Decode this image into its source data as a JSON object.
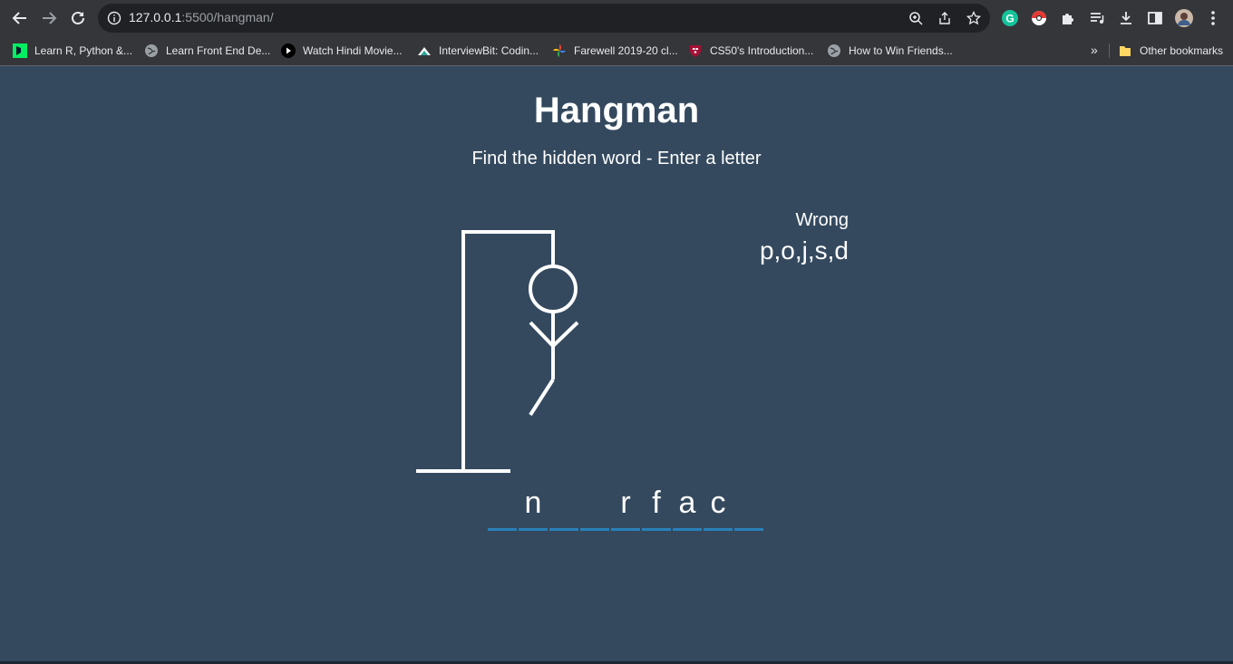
{
  "browser": {
    "url_host": "127.0.0.1",
    "url_rest": ":5500/hangman/",
    "bookmarks": [
      {
        "label": "Learn R, Python &..."
      },
      {
        "label": "Learn Front End De..."
      },
      {
        "label": "Watch Hindi Movie..."
      },
      {
        "label": "InterviewBit: Codin..."
      },
      {
        "label": "Farewell 2019-20 cl..."
      },
      {
        "label": "CS50's Introduction..."
      },
      {
        "label": "How to Win Friends..."
      }
    ],
    "overflow": "»",
    "other_bookmarks": "Other bookmarks"
  },
  "game": {
    "title": "Hangman",
    "subtitle": "Find the hidden word - Enter a letter",
    "wrong_label": "Wrong",
    "wrong_letters": "p,o,j,s,d",
    "word_slots": [
      "",
      "n",
      "",
      "",
      "r",
      "f",
      "a",
      "c",
      ""
    ]
  },
  "colors": {
    "background": "#34495e",
    "slot_underline": "#2980b9",
    "figure": "#ffffff"
  }
}
